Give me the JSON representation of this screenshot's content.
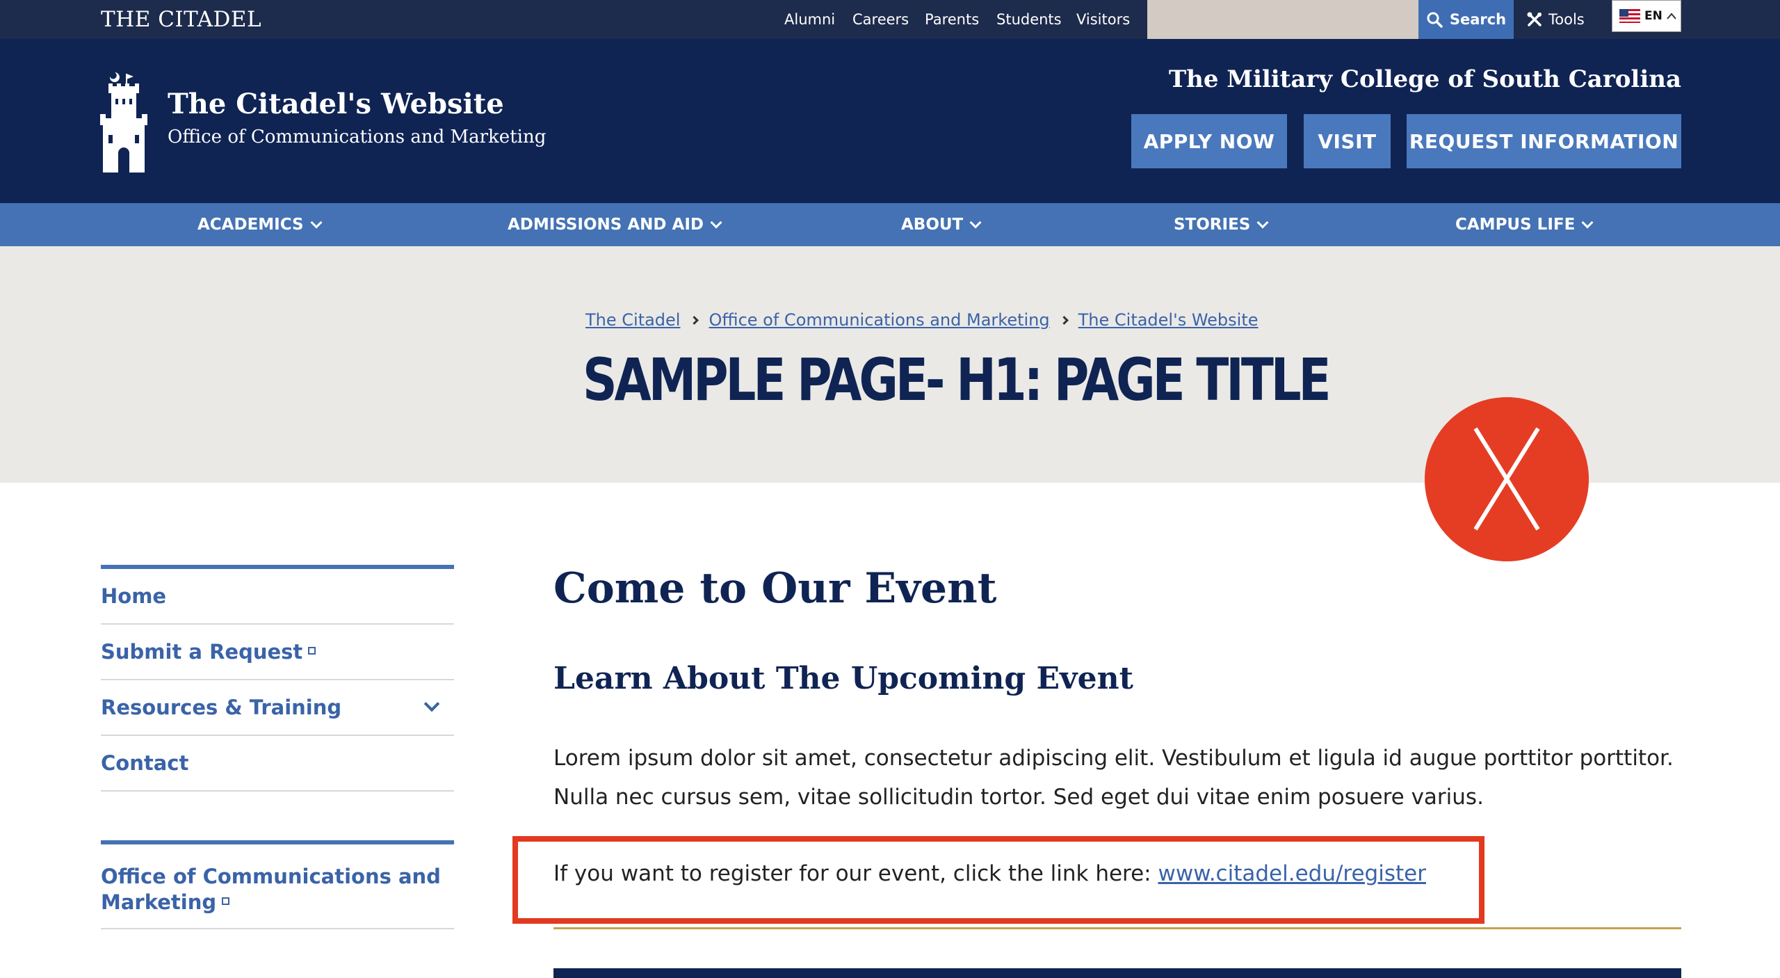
{
  "utility": {
    "wordmark": "THE CITADEL",
    "links": [
      "Alumni",
      "Careers",
      "Parents",
      "Students",
      "Visitors"
    ],
    "search_label": "Search",
    "tools_label": "Tools",
    "language": "EN"
  },
  "masthead": {
    "site_title": "The Citadel's Website",
    "site_subtitle": "Office of Communications and Marketing",
    "tagline": "The Military College of South Carolina",
    "cta": [
      "APPLY NOW",
      "VISIT",
      "REQUEST INFORMATION"
    ]
  },
  "nav": [
    "ACADEMICS",
    "ADMISSIONS AND AID",
    "ABOUT",
    "STORIES",
    "CAMPUS LIFE"
  ],
  "hero": {
    "breadcrumb": [
      "The Citadel",
      "Office of Communications and Marketing",
      "The Citadel's Website"
    ],
    "page_title": "SAMPLE PAGE- H1: PAGE TITLE"
  },
  "sidebar": {
    "items": [
      "Home",
      "Submit a Request",
      "Resources & Training",
      "Contact"
    ],
    "section_link": "Office of Communications and Marketing"
  },
  "content": {
    "heading": "Come to Our Event",
    "subheading": "Learn About The Upcoming Event",
    "paragraph": "Lorem ipsum dolor sit amet, consectetur adipiscing elit. Vestibulum et ligula id augue porttitor porttitor. Nulla nec cursus sem, vitae sollicitudin tortor. Sed eget dui vitae enim posuere varius.",
    "register_text": "If you want to register for our event, click the link here: ",
    "register_link": "www.citadel.edu/register"
  },
  "colors": {
    "navy": "#0f2453",
    "utility_bar": "#1d2b4c",
    "accent_blue": "#4472b4",
    "link_blue": "#3a63a8",
    "annotation_red": "#e53d24",
    "gold": "#c5a24a"
  },
  "icons": [
    "search-icon",
    "tools-icon",
    "us-flag-icon",
    "chevron-up-icon",
    "castle-logo",
    "chevron-down-icon",
    "external-link-icon",
    "x-mark-icon"
  ]
}
